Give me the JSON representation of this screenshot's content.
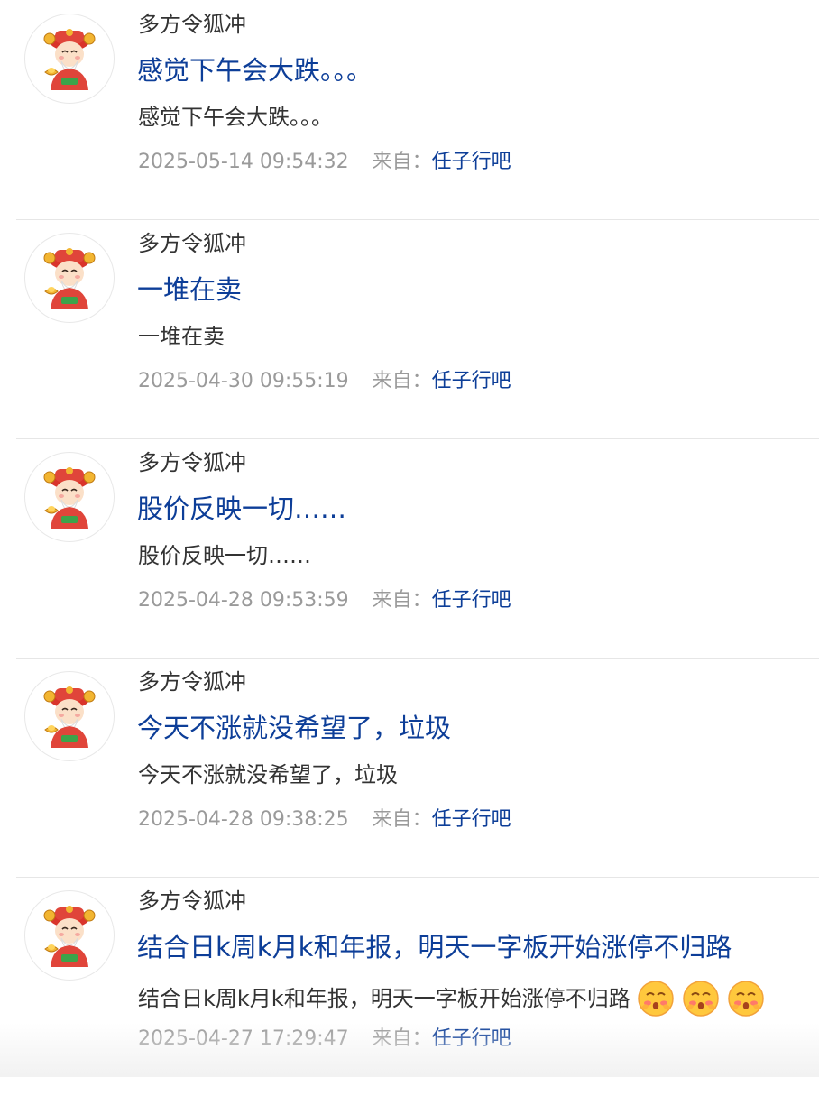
{
  "accent_color": "#0d3e98",
  "posts": [
    {
      "author": "多方令狐冲",
      "title": "感觉下午会大跌。。。",
      "body": "感觉下午会大跌。。。",
      "date": "2025-05-14 09:54:32",
      "from_label": "来自：",
      "source": "任子行吧",
      "emojis": []
    },
    {
      "author": "多方令狐冲",
      "title": "一堆在卖",
      "body": "一堆在卖",
      "date": "2025-04-30 09:55:19",
      "from_label": "来自：",
      "source": "任子行吧",
      "emojis": []
    },
    {
      "author": "多方令狐冲",
      "title": "股价反映一切……",
      "body": "股价反映一切……",
      "date": "2025-04-28 09:53:59",
      "from_label": "来自：",
      "source": "任子行吧",
      "emojis": []
    },
    {
      "author": "多方令狐冲",
      "title": "今天不涨就没希望了，垃圾",
      "body": "今天不涨就没希望了，垃圾",
      "date": "2025-04-28 09:38:25",
      "from_label": "来自：",
      "source": "任子行吧",
      "emojis": []
    },
    {
      "author": "多方令狐冲",
      "title": "结合日k周k月k和年报，明天一字板开始涨停不归路",
      "body": "结合日k周k月k和年报，明天一字板开始涨停不归路",
      "date": "2025-04-27 17:29:47",
      "from_label": "来自：",
      "source": "任子行吧",
      "emojis": [
        "blushing-face-icon",
        "blushing-face-icon",
        "blushing-face-icon"
      ]
    }
  ]
}
